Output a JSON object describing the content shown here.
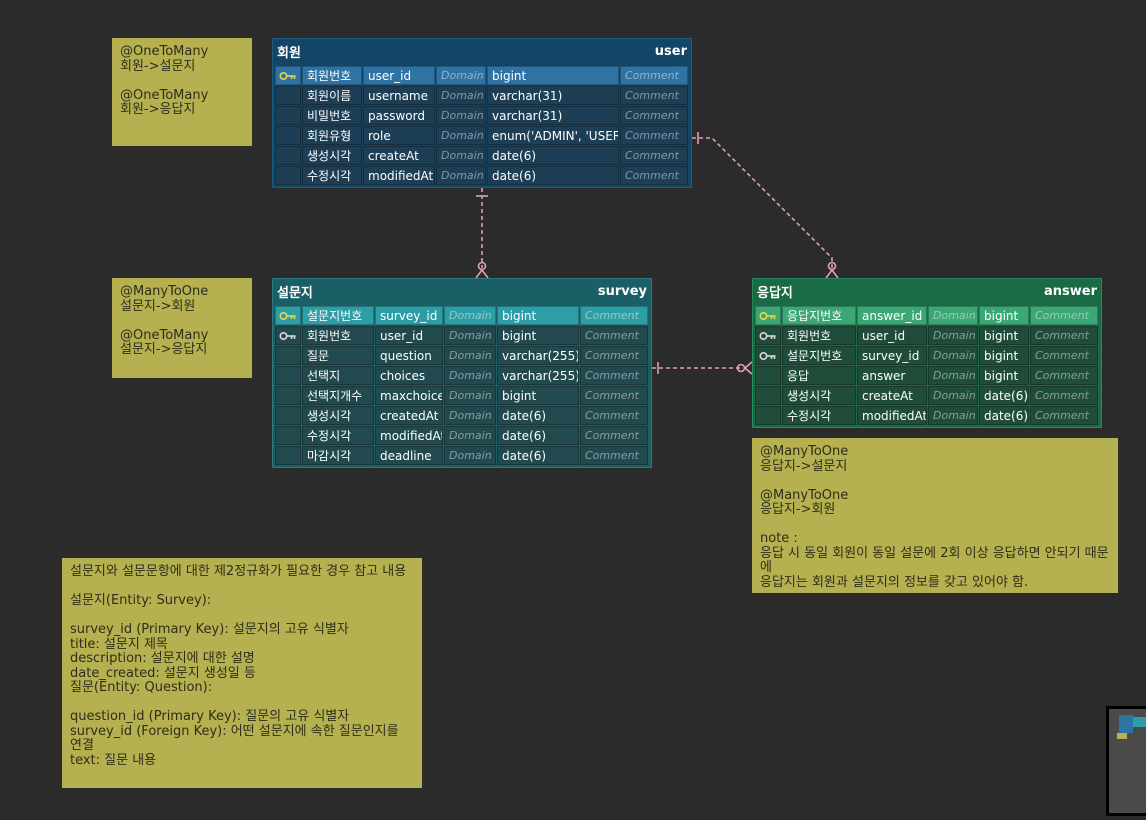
{
  "notes": {
    "user_note": "@OneToMany\n회원->설문지\n\n@OneToMany\n회원->응답지",
    "survey_note": "@ManyToOne\n설문지->회원\n\n@OneToMany\n설문지->응답지",
    "answer_note": "@ManyToOne\n응답지->설문지\n\n@ManyToOne\n응답지->회원\n\nnote :\n응답 시 동일 회원이 동일 설문에 2회 이상 응답하면 안되기 때문에\n응답지는 회원과 설문지의 정보를 갖고 있어야 함.",
    "normalization_note": "설문지와 설문문항에 대한 제2정규화가 필요한 경우 참고 내용\n\n설문지(Entity: Survey):\n\nsurvey_id (Primary Key): 설문지의 고유 식별자\ntitle: 설문지 제목\ndescription: 설문지에 대한 설명\ndate_created: 설문지 생성일 등\n질문(Entity: Question):\n\nquestion_id (Primary Key): 질문의 고유 식별자\nsurvey_id (Foreign Key): 어떤 설문지에 속한 질문인지를 연결\ntext: 질문 내용"
  },
  "tables": {
    "user": {
      "logical": "회원",
      "physical": "user",
      "rows": [
        {
          "key": "pk",
          "logical": "회원번호",
          "physical": "user_id",
          "domain": "Domain",
          "type": "bigint",
          "comment": "Comment"
        },
        {
          "key": "",
          "logical": "회원이름",
          "physical": "username",
          "domain": "Domain",
          "type": "varchar(31)",
          "comment": "Comment"
        },
        {
          "key": "",
          "logical": "비밀번호",
          "physical": "password",
          "domain": "Domain",
          "type": "varchar(31)",
          "comment": "Comment"
        },
        {
          "key": "",
          "logical": "회원유형",
          "physical": "role",
          "domain": "Domain",
          "type": "enum('ADMIN', 'USER')",
          "comment": "Comment"
        },
        {
          "key": "",
          "logical": "생성시각",
          "physical": "createAt",
          "domain": "Domain",
          "type": "date(6)",
          "comment": "Comment"
        },
        {
          "key": "",
          "logical": "수정시각",
          "physical": "modifiedAt",
          "domain": "Domain",
          "type": "date(6)",
          "comment": "Comment"
        }
      ]
    },
    "survey": {
      "logical": "설문지",
      "physical": "survey",
      "rows": [
        {
          "key": "pk",
          "logical": "설문지번호",
          "physical": "survey_id",
          "domain": "Domain",
          "type": "bigint",
          "comment": "Comment"
        },
        {
          "key": "fk",
          "logical": "회원번호",
          "physical": "user_id",
          "domain": "Domain",
          "type": "bigint",
          "comment": "Comment"
        },
        {
          "key": "",
          "logical": "질문",
          "physical": "question",
          "domain": "Domain",
          "type": "varchar(255)",
          "comment": "Comment"
        },
        {
          "key": "",
          "logical": "선택지",
          "physical": "choices",
          "domain": "Domain",
          "type": "varchar(255)",
          "comment": "Comment"
        },
        {
          "key": "",
          "logical": "선택지개수",
          "physical": "maxchoice",
          "domain": "Domain",
          "type": "bigint",
          "comment": "Comment"
        },
        {
          "key": "",
          "logical": "생성시각",
          "physical": "createdAt",
          "domain": "Domain",
          "type": "date(6)",
          "comment": "Comment"
        },
        {
          "key": "",
          "logical": "수정시각",
          "physical": "modifiedAt",
          "domain": "Domain",
          "type": "date(6)",
          "comment": "Comment"
        },
        {
          "key": "",
          "logical": "마감시각",
          "physical": "deadline",
          "domain": "Domain",
          "type": "date(6)",
          "comment": "Comment"
        }
      ]
    },
    "answer": {
      "logical": "응답지",
      "physical": "answer",
      "rows": [
        {
          "key": "pk",
          "logical": "응답지번호",
          "physical": "answer_id",
          "domain": "Domain",
          "type": "bigint",
          "comment": "Comment"
        },
        {
          "key": "fk",
          "logical": "회원번호",
          "physical": "user_id",
          "domain": "Domain",
          "type": "bigint",
          "comment": "Comment"
        },
        {
          "key": "fk",
          "logical": "설문지번호",
          "physical": "survey_id",
          "domain": "Domain",
          "type": "bigint",
          "comment": "Comment"
        },
        {
          "key": "",
          "logical": "응답",
          "physical": "answer",
          "domain": "Domain",
          "type": "bigint",
          "comment": "Comment"
        },
        {
          "key": "",
          "logical": "생성시각",
          "physical": "createAt",
          "domain": "Domain",
          "type": "date(6)",
          "comment": "Comment"
        },
        {
          "key": "",
          "logical": "수정시각",
          "physical": "modifiedAt",
          "domain": "Domain",
          "type": "date(6)",
          "comment": "Comment"
        }
      ]
    }
  },
  "colors": {
    "relation_line": "#e0a0b0",
    "pk_key_icon": "#e8d44d",
    "fk_key_icon": "#d9d9d9"
  }
}
